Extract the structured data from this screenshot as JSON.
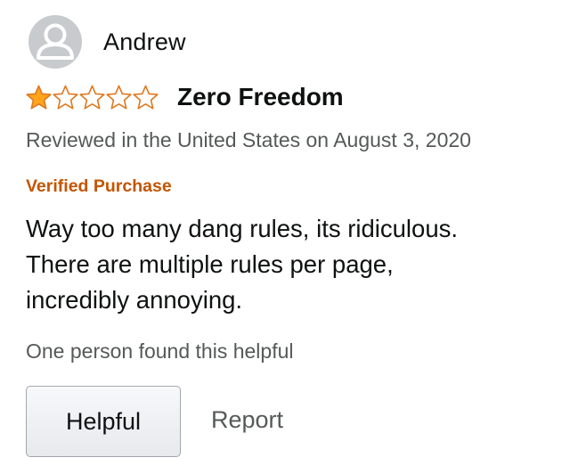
{
  "reviewer": {
    "name": "Andrew",
    "avatar_icon": "default-user-avatar"
  },
  "rating": {
    "value": 1,
    "max": 5,
    "filled_color": "#ffa41c",
    "outline_color": "#de7921"
  },
  "review": {
    "title": "Zero Freedom",
    "date": "Reviewed in the United States on August 3, 2020",
    "verified_label": "Verified Purchase",
    "body_lines": [
      "Way too many dang rules, its ridiculous.",
      "There are multiple rules per page,",
      "incredibly annoying."
    ]
  },
  "footer": {
    "helpful_count": "One person found this helpful",
    "helpful_button": "Helpful",
    "report_link": "Report"
  },
  "colors": {
    "verified": "#c45500",
    "secondary_text": "#565959",
    "primary_text": "#0f1111"
  }
}
